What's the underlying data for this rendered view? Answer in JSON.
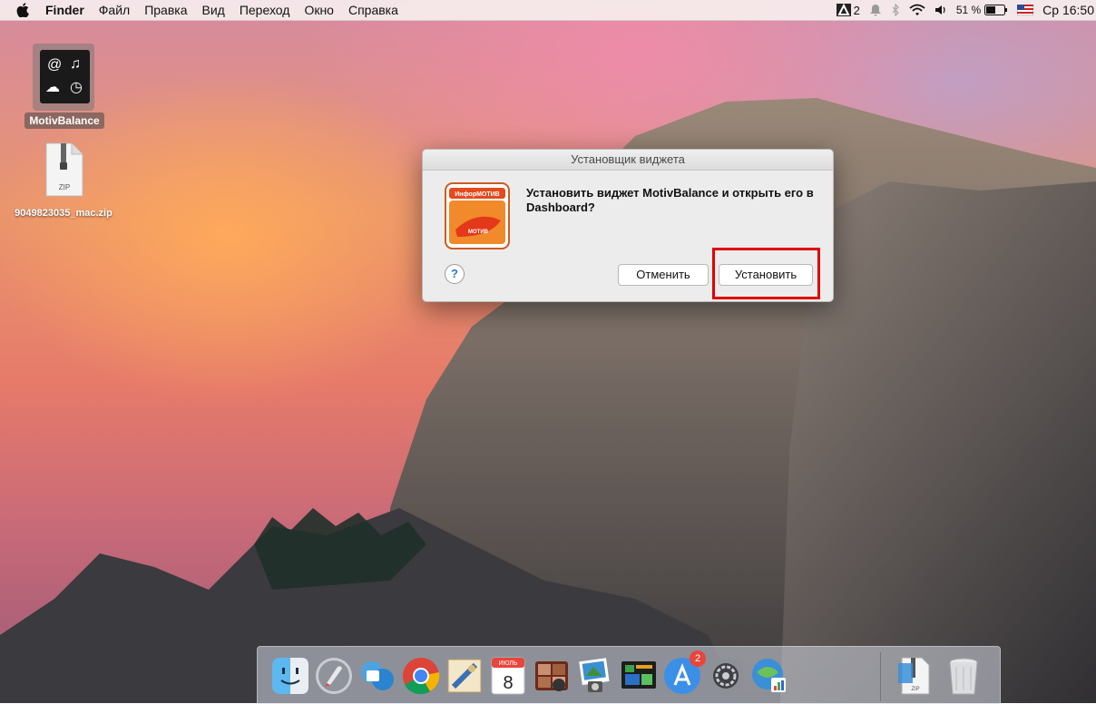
{
  "menubar": {
    "app": "Finder",
    "items": [
      "Файл",
      "Правка",
      "Вид",
      "Переход",
      "Окно",
      "Справка"
    ],
    "status": {
      "adobe_count": "2",
      "battery": "51 %",
      "clock": "Ср 16:50"
    }
  },
  "desktop": {
    "widget_label": "MotivBalance",
    "zip_badge": "ZIP",
    "zip_label": "9049823035_mac.zip"
  },
  "dialog": {
    "title": "Установщик виджета",
    "message": "Установить виджет MotivBalance и открыть его в Dashboard?",
    "logo_text_top": "ИнфорМОТИВ",
    "logo_text_bottom": "МОТИВ",
    "help_label": "?",
    "cancel_label": "Отменить",
    "install_label": "Установить"
  },
  "dock": {
    "calendar_month": "ИЮЛЬ",
    "calendar_day": "8",
    "appstore_badge": "2",
    "zip_badge": "ZIP"
  },
  "colors": {
    "highlight": "#e00000",
    "accent": "#2b74d8"
  }
}
